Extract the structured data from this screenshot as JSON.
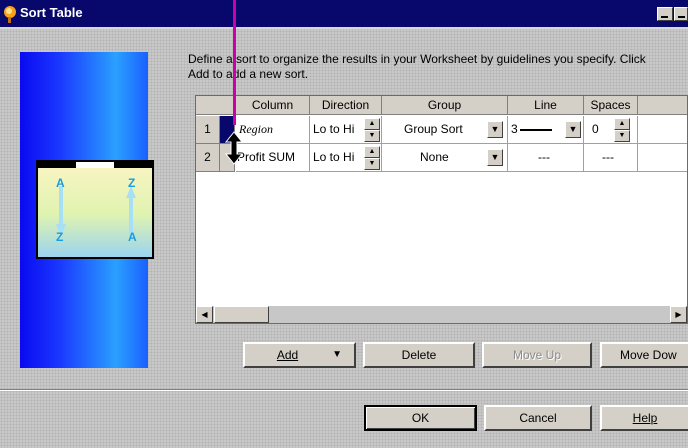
{
  "window": {
    "title": "Sort Table"
  },
  "description": "Define a sort to organize the results in your Worksheet by guidelines you specify. Click Add to add a new sort.",
  "art": {
    "letters": [
      "A",
      "Z",
      "Z",
      "A"
    ]
  },
  "grid": {
    "headers": [
      "Column",
      "Direction",
      "Group",
      "Line",
      "Spaces"
    ],
    "rows": [
      {
        "num": "1",
        "column": "Region",
        "direction": "Lo to Hi",
        "group": "Group Sort",
        "line": "3",
        "spaces": "0"
      },
      {
        "num": "2",
        "column": "Profit SUM",
        "direction": "Lo to Hi",
        "group": "None",
        "line": "---",
        "spaces": "---"
      }
    ]
  },
  "buttons": {
    "add": "Add",
    "delete": "Delete",
    "move_up": "Move Up",
    "move_down": "Move Dow",
    "ok": "OK",
    "cancel": "Cancel",
    "help": "Help"
  },
  "colors": {
    "title_bar": "#08086c",
    "pointer": "#cc00aa",
    "dialog": "#c8c8c8"
  },
  "icons": [
    "app-icon",
    "minimize-icon",
    "spinner-up-icon",
    "spinner-down-icon",
    "dropdown-arrow-icon",
    "resize-cursor-icon",
    "scroll-left-icon",
    "scroll-right-icon"
  ]
}
